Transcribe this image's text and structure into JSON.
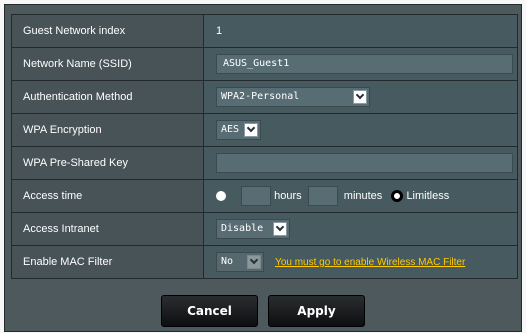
{
  "form": {
    "rows": {
      "index": {
        "label": "Guest Network index",
        "value": "1"
      },
      "ssid": {
        "label": "Network Name (SSID)",
        "value": "ASUS_Guest1"
      },
      "auth": {
        "label": "Authentication Method",
        "value": "WPA2-Personal"
      },
      "encryption": {
        "label": "WPA Encryption",
        "value": "AES"
      },
      "psk": {
        "label": "WPA Pre-Shared Key",
        "value": ""
      },
      "access_time": {
        "label": "Access time",
        "hours_value": "",
        "hours_label": "hours",
        "minutes_value": "",
        "minutes_label": "minutes",
        "limitless_label": "Limitless",
        "selected": "Limitless"
      },
      "intranet": {
        "label": "Access Intranet",
        "value": "Disable"
      },
      "mac_filter": {
        "label": "Enable MAC Filter",
        "value": "No",
        "link": "You must go to enable Wireless MAC Filter"
      }
    }
  },
  "buttons": {
    "cancel": "Cancel",
    "apply": "Apply"
  },
  "colors": {
    "panel": "#4d595d",
    "row": "#475a5f",
    "link": "#ffcc00"
  }
}
